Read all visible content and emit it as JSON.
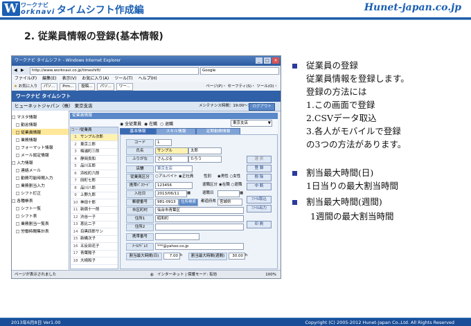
{
  "header": {
    "logo_letter": "W",
    "logo_small": "ワークナビ",
    "logo_sub": "orknavi",
    "logo_main": "タイムシフト作成編",
    "site": "Hunet-japan.co.jp"
  },
  "slide_title": "2. 従業員情報の登録(基本情報)",
  "browser": {
    "window_title": "ワークナビ タイムシフト - Windows Internet Explorer",
    "address": "http://www.worknavi.co.jp/timeshift/",
    "search_engine": "Google",
    "menu": [
      "ファイル(F)",
      "編集(E)",
      "表示(V)",
      "お気に入り(A)",
      "ツール(T)",
      "ヘルプ(H)"
    ],
    "favorites_label": "お気に入り",
    "fav_tabs": [
      "パソ...",
      "Prm...",
      "投稿...",
      "パソ...",
      "ワー..."
    ],
    "toolbar_right": "ページ(P)・ セーフティ(S)・ ツール(O)・",
    "status": "ページが表示されました",
    "status_right": "インターネット | 保護モード: 有効",
    "zoom": "100%"
  },
  "app": {
    "title": "ワークナビ タイムシフト",
    "company": "ヒューネットジャパン（株） 東京支店",
    "maintenance": "メンテナンス時間：19:00〜19:59",
    "logout": "ログアウト"
  },
  "sidebar": {
    "items": [
      {
        "label": "□ マスタ情報",
        "sel": false
      },
      {
        "label": "　□ 勤怠情報",
        "sel": false
      },
      {
        "label": "　□ 従業員情報",
        "sel": true
      },
      {
        "label": "　□ 業務情報",
        "sel": false
      },
      {
        "label": "　□ フォーマット情報",
        "sel": false
      },
      {
        "label": "　□ メール設定情報",
        "sel": false
      },
      {
        "label": "□ 入力情報",
        "sel": false
      },
      {
        "label": "　□ 連絡メール",
        "sel": false
      },
      {
        "label": "　□ 勤務可能時間入力",
        "sel": false
      },
      {
        "label": "　□ 業務割当入力",
        "sel": false
      },
      {
        "label": "　□ シフト訂正",
        "sel": false
      },
      {
        "label": "□ 各種帳表",
        "sel": false
      },
      {
        "label": "　□ シフト一覧",
        "sel": false
      },
      {
        "label": "　□ シフト表",
        "sel": false
      },
      {
        "label": "　□ 業務割当一覧表",
        "sel": false
      },
      {
        "label": "　□ 労働時間集計表",
        "sel": false
      }
    ]
  },
  "panel": {
    "header": "従業員情報",
    "radio_all": "全従業員",
    "radio_active": "在職",
    "radio_retired": "退職",
    "branch": "東京支店",
    "tabs": [
      "基本情報",
      "スキル情報",
      "定期勤務情報"
    ]
  },
  "emplist": {
    "head_code": "コード",
    "head_name": "従業員",
    "rows": [
      {
        "code": "1",
        "name": "サンプル次郎",
        "sel": true
      },
      {
        "code": "2",
        "name": "東京二郎",
        "sel": false
      },
      {
        "code": "3",
        "name": "梅浦町三郎",
        "sel": false
      },
      {
        "code": "4",
        "name": "静岡良和",
        "sel": false
      },
      {
        "code": "5",
        "name": "品川五郎",
        "sel": false
      },
      {
        "code": "6",
        "name": "浜松町六郎",
        "sel": false
      },
      {
        "code": "7",
        "name": "田町七郎",
        "sel": false
      },
      {
        "code": "8",
        "name": "品川八郎",
        "sel": false
      },
      {
        "code": "9",
        "name": "上野九郎",
        "sel": false
      },
      {
        "code": "10",
        "name": "神田十郎",
        "sel": false
      },
      {
        "code": "11",
        "name": "新宿十一郎",
        "sel": false
      },
      {
        "code": "12",
        "name": "渋谷一子",
        "sel": false
      },
      {
        "code": "13",
        "name": "恵比二子",
        "sel": false
      },
      {
        "code": "14",
        "name": "目黒四郎サン",
        "sel": false
      },
      {
        "code": "15",
        "name": "新橋次子",
        "sel": false
      },
      {
        "code": "16",
        "name": "五反田花子",
        "sel": false
      },
      {
        "code": "17",
        "name": "青葉陽子",
        "sel": false
      },
      {
        "code": "18",
        "name": "大崎和子",
        "sel": false
      }
    ]
  },
  "form": {
    "code_label": "コード",
    "code_value": "1",
    "name_label": "氏名",
    "name_last": "サンプル",
    "name_first": "太郎",
    "kana_label": "ふりがな",
    "kana_last": "さんぷる",
    "kana_first": "たろう",
    "branch_label": "店舗",
    "branch_value": "東京支店",
    "emp_type_label": "従業員区分",
    "emp_type_part": "アルバイト",
    "emp_type_full": "正社員",
    "gender_label": "性別",
    "gender_m": "男性",
    "gender_f": "女性",
    "phone_label": "携帯ﾊﾟｽﾜｰﾄﾞ",
    "phone_value": "123456",
    "status_label": "退職区分",
    "status_active": "在職",
    "status_retired": "退職",
    "join_label": "入社日",
    "join_value": "2013/06/11",
    "leave_label": "退職日",
    "zip_label": "郵便番号",
    "zip_value": "981-0913",
    "zip_search": "住所検索",
    "pref_label": "都道府県",
    "pref_value": "宮城県",
    "city_label": "市区町村",
    "city_value": "仙台市青葉区",
    "addr1_label": "住所1",
    "addr1_value": "昭和町",
    "addr2_label": "住所2",
    "mobile_label": "携帯番号",
    "mail_label": "ﾒｰﾙｱﾄﾞﾚｽ",
    "mail_value": "***@yahoo.co.jp",
    "max_day_label": "割当最大時間(日)",
    "max_day_value": "7.00",
    "max_day_unit": "h",
    "max_week_label": "割当最大時間(週間)",
    "max_week_value": "30.00",
    "max_week_unit": "h"
  },
  "form_buttons": {
    "select": "選 択",
    "register": "登 録",
    "delete": "削 除",
    "cancel": "中 断",
    "file_import": "ﾌｧｲﾙ取込",
    "file_export": "ﾌｧｲﾙ出力",
    "print": "印 刷"
  },
  "right": {
    "b1_title": "従業員の登録",
    "b1_lines": [
      "従業員情報を登録します。",
      "登録の方法には",
      "1.この画面で登録",
      "2.CSVデータ取込",
      "3.各人がモバイルで登録",
      "の3つの方法があります。"
    ],
    "b2_title": "割当最大時間(日)",
    "b2_line": "1日当りの最大割当時間",
    "b3_title": "割当最大時間(週間)",
    "b3_line": "1週間の最大割当時間"
  },
  "footer": {
    "date": "2013年6月8日 Ver1.00",
    "copyright": "Copyright (C) 2005-2012 Hunet-Japan Co.,Ltd. All Rights Reserved"
  },
  "colors": {
    "brand": "#1a5fb4",
    "bullet": "#2b3a9c",
    "footer": "#1a4d97",
    "app_bar": "#3060a8"
  }
}
